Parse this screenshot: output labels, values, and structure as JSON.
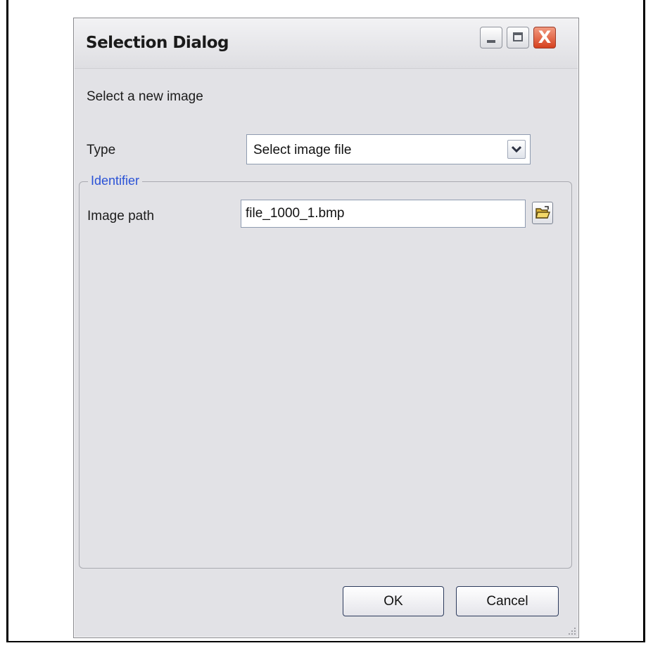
{
  "window": {
    "title": "Selection Dialog"
  },
  "titlebar_buttons": {
    "minimize_icon": "minimize-icon",
    "maximize_icon": "maximize-icon",
    "close_glyph": "X"
  },
  "dialog": {
    "instruction": "Select a new image",
    "type_label": "Type",
    "type_value": "Select image file",
    "group_title": "Identifier",
    "path_label": "Image path",
    "path_value": "file_1000_1.bmp"
  },
  "buttons": {
    "ok": "OK",
    "cancel": "Cancel"
  },
  "colors": {
    "group_title": "#2a52d6",
    "close_button": "#d6411f"
  }
}
